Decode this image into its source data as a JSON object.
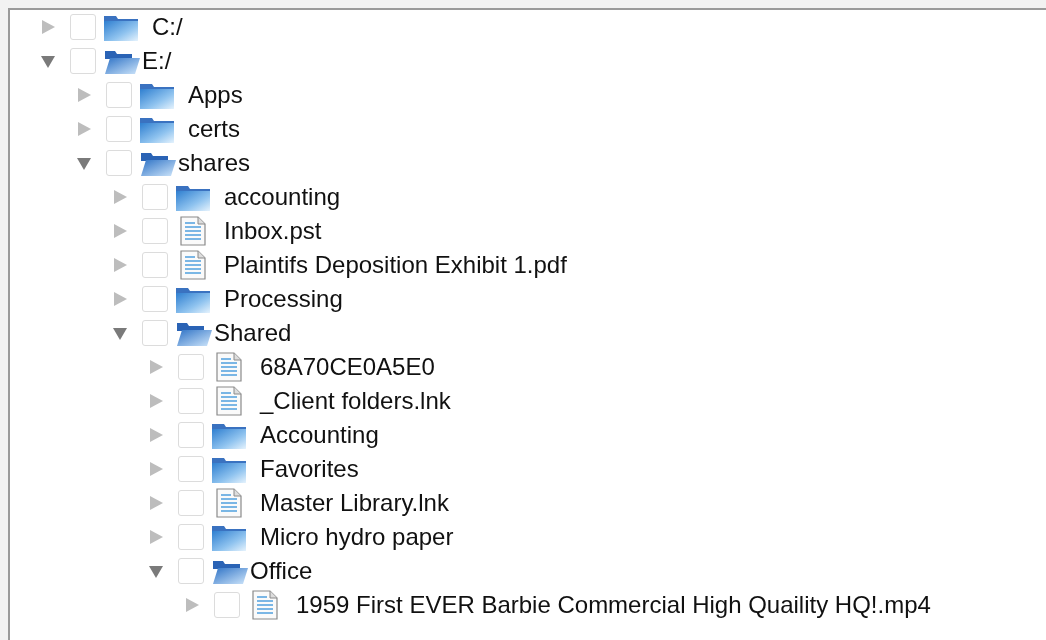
{
  "tree": [
    {
      "name": "C:/",
      "kind": "folder",
      "expanded": false,
      "checked": false
    },
    {
      "name": "E:/",
      "kind": "folder",
      "expanded": true,
      "checked": false,
      "children": [
        {
          "name": "Apps",
          "kind": "folder",
          "expanded": false,
          "checked": false
        },
        {
          "name": "certs",
          "kind": "folder",
          "expanded": false,
          "checked": false
        },
        {
          "name": "shares",
          "kind": "folder",
          "expanded": true,
          "checked": false,
          "children": [
            {
              "name": "accounting",
              "kind": "folder",
              "expanded": false,
              "checked": false
            },
            {
              "name": "Inbox.pst",
              "kind": "file",
              "expanded": false,
              "checked": false
            },
            {
              "name": "Plaintifs Deposition Exhibit 1.pdf",
              "kind": "file",
              "expanded": false,
              "checked": false
            },
            {
              "name": "Processing",
              "kind": "folder",
              "expanded": false,
              "checked": false
            },
            {
              "name": "Shared",
              "kind": "folder",
              "expanded": true,
              "checked": false,
              "children": [
                {
                  "name": "68A70CE0A5E0",
                  "kind": "file",
                  "expanded": false,
                  "checked": false
                },
                {
                  "name": "_Client folders.lnk",
                  "kind": "file",
                  "expanded": false,
                  "checked": false
                },
                {
                  "name": "Accounting",
                  "kind": "folder",
                  "expanded": false,
                  "checked": false
                },
                {
                  "name": "Favorites",
                  "kind": "folder",
                  "expanded": false,
                  "checked": false
                },
                {
                  "name": "Master Library.lnk",
                  "kind": "file",
                  "expanded": false,
                  "checked": false
                },
                {
                  "name": "Micro hydro paper",
                  "kind": "folder",
                  "expanded": false,
                  "checked": false
                },
                {
                  "name": "Office",
                  "kind": "folder",
                  "expanded": true,
                  "checked": false,
                  "children": [
                    {
                      "name": "1959 First EVER Barbie Commercial High Quaility HQ!.mp4",
                      "kind": "file",
                      "expanded": false,
                      "checked": false
                    }
                  ]
                }
              ]
            }
          ]
        }
      ]
    }
  ]
}
